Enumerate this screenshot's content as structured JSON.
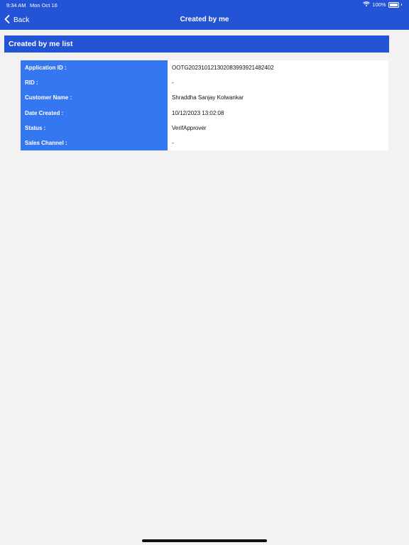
{
  "status_bar": {
    "time": "9:34 AM",
    "date": "Mon Oct 16",
    "battery": "100%"
  },
  "nav": {
    "back_label": "Back",
    "title": "Created by me"
  },
  "section": {
    "title": "Created by me list"
  },
  "details": [
    {
      "label": "Application ID :",
      "value": "OOTG2023101213020839939214824​02"
    },
    {
      "label": "RID :",
      "value": "-"
    },
    {
      "label": "Customer Name :",
      "value": "Shraddha Sanjay Kolwankar"
    },
    {
      "label": "Date Created :",
      "value": "10/12/2023 13:02:08"
    },
    {
      "label": "Status :",
      "value": "VerifApprover"
    },
    {
      "label": "Sales Channel :",
      "value": "-"
    }
  ],
  "colors": {
    "primary": "#2454d6",
    "label_bg": "#3577f0",
    "page_bg": "#f2f2f2"
  }
}
